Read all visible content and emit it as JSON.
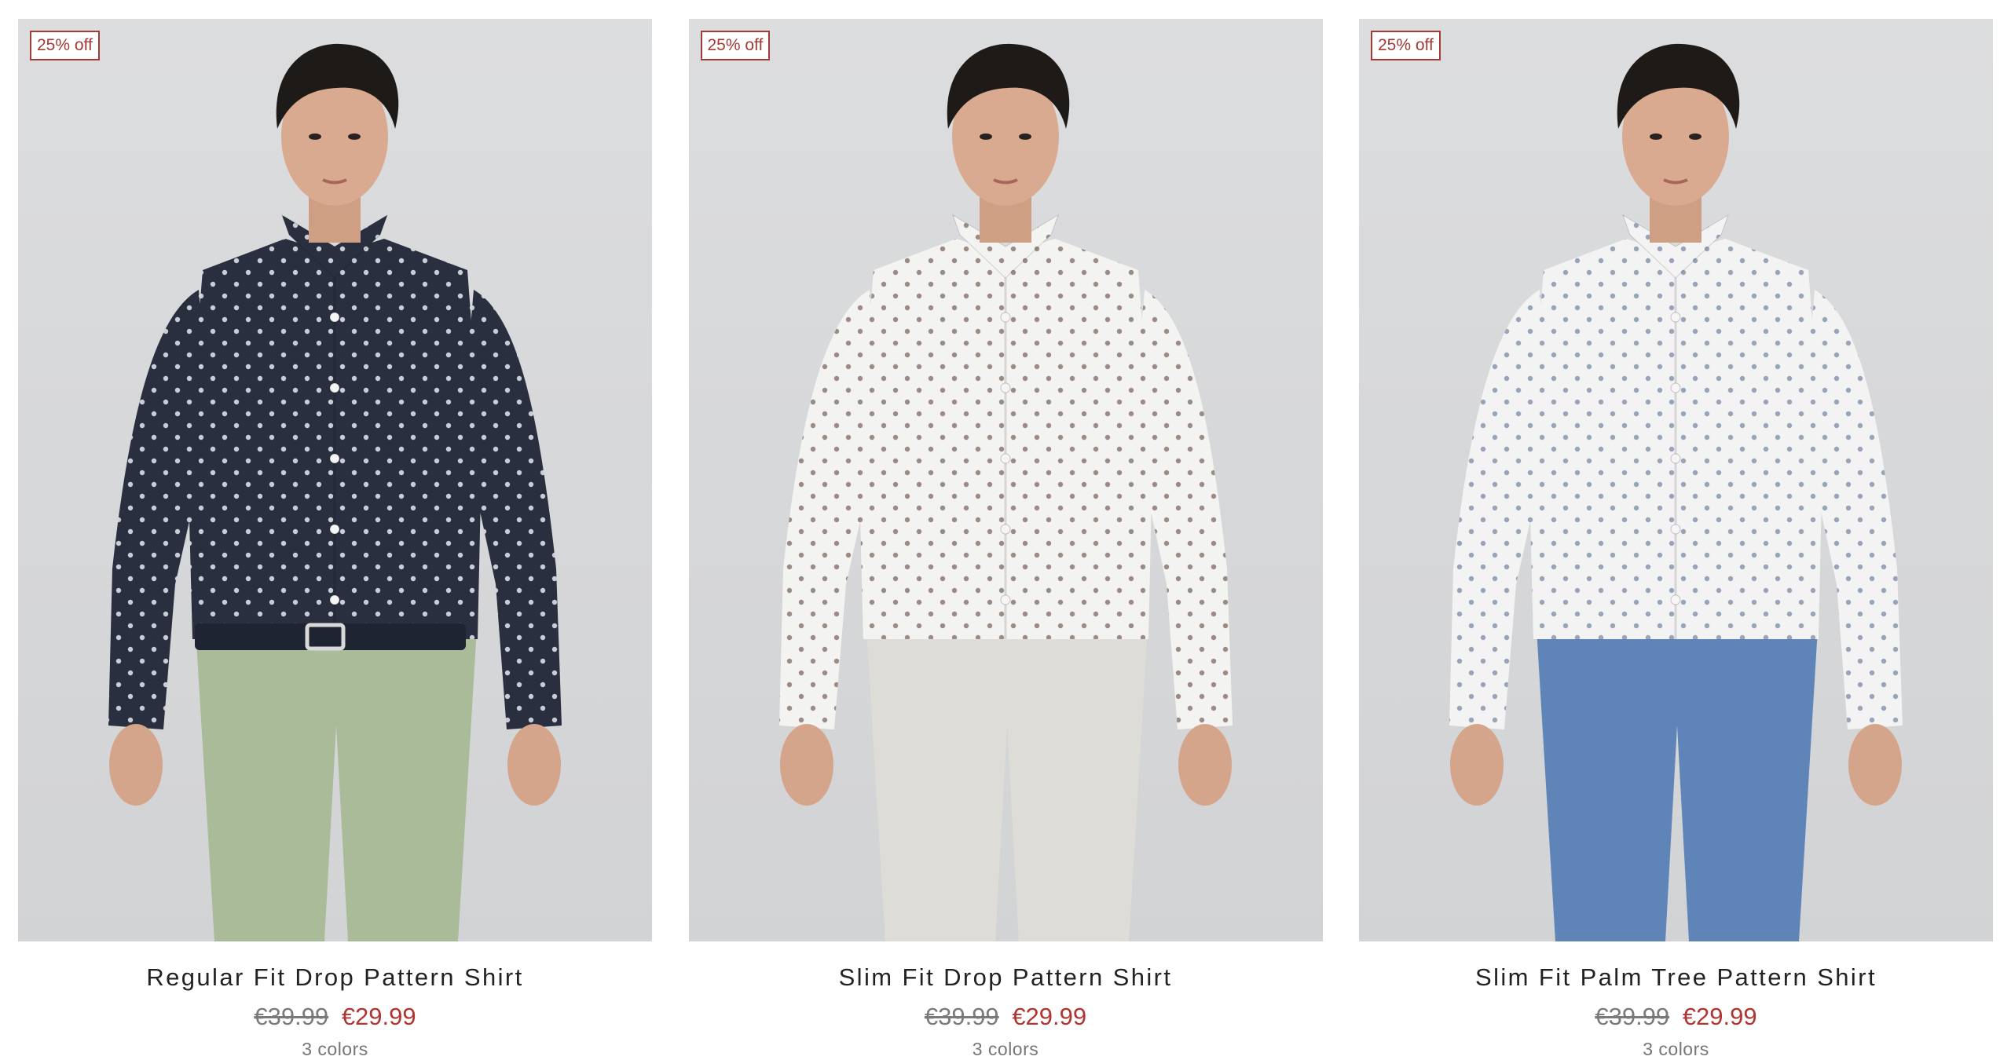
{
  "products": [
    {
      "badge": "25% off",
      "name": "Regular Fit Drop Pattern Shirt",
      "price_old": "€39.99",
      "price_new": "€29.99",
      "colors": "3 colors",
      "shirt_color": "#2a2f3f",
      "dot_color": "#c9ced6",
      "pants_color": "#a9bb98",
      "belt": true
    },
    {
      "badge": "25% off",
      "name": "Slim Fit Drop Pattern Shirt",
      "price_old": "€39.99",
      "price_new": "€29.99",
      "colors": "3 colors",
      "shirt_color": "#f3f3f1",
      "dot_color": "#9a8c84",
      "pants_color": "#dedcd6",
      "belt": false
    },
    {
      "badge": "25% off",
      "name": "Slim Fit Palm Tree Pattern Shirt",
      "price_old": "€39.99",
      "price_new": "€29.99",
      "colors": "3 colors",
      "shirt_color": "#f3f3f3",
      "dot_color": "#9aa4b8",
      "pants_color": "#5f84b8",
      "belt": false
    }
  ],
  "colors": {
    "sale_red": "#b0342f",
    "badge_border": "#a33a36",
    "photo_bg": "#d8d9db"
  }
}
